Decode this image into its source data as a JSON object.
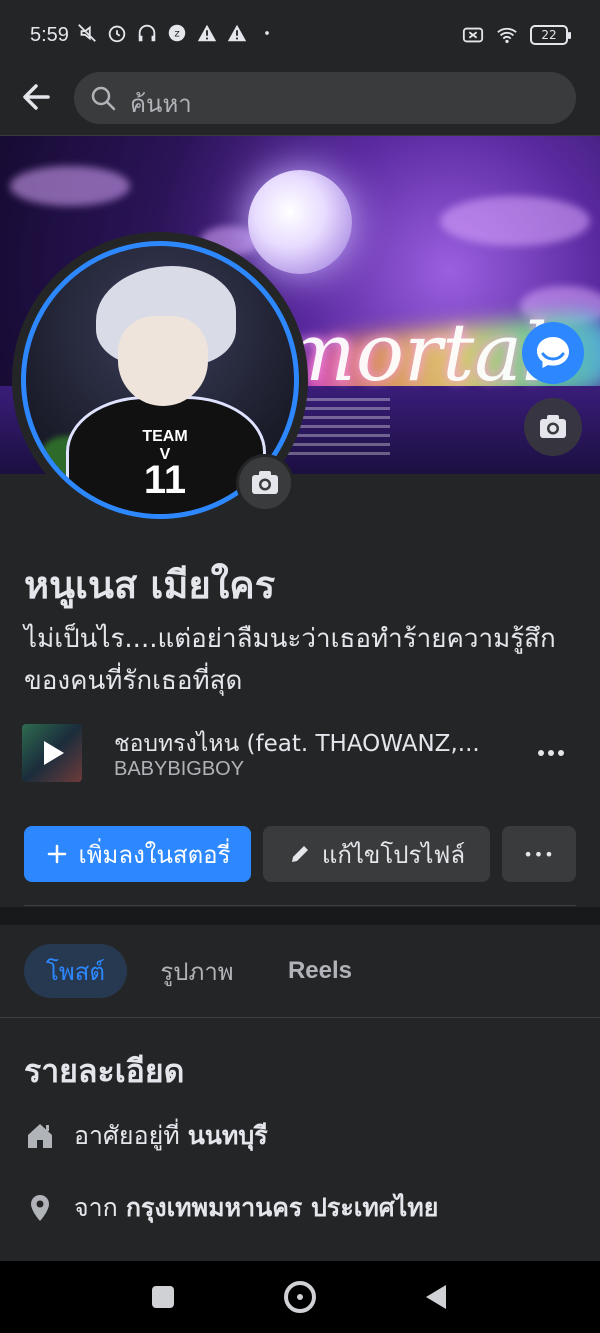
{
  "status_bar": {
    "time": "5:59",
    "battery": "22"
  },
  "header": {
    "search_placeholder": "ค้นหา"
  },
  "cover": {
    "word": "mortal"
  },
  "profile": {
    "name": "หนูเนส เมียใคร",
    "bio": "ไม่เป็นไร....แต่อย่าลืมนะว่าเธอทำร้ายความรู้สึกของคนที่รักเธอที่สุด"
  },
  "music": {
    "title": "ชอบทรงไหน (feat. THAOWANZ,...",
    "artist": "BABYBIGBOY"
  },
  "actions": {
    "story_label": "เพิ่มลงในสตอรี่",
    "edit_label": "แก้ไขโปรไฟล์",
    "more_label": "•••"
  },
  "tabs": {
    "posts": "โพสต์",
    "photos": "รูปภาพ",
    "reels": "Reels"
  },
  "details": {
    "title": "รายละเอียด",
    "lives_prefix": "อาศัยอยู่ที่",
    "lives_value": "นนทบุรี",
    "from_prefix": "จาก",
    "from_value": "กรุงเทพมหานคร ประเทศไทย"
  },
  "colors": {
    "accent": "#2d88ff",
    "background": "#242526",
    "surface": "#3a3b3c"
  }
}
